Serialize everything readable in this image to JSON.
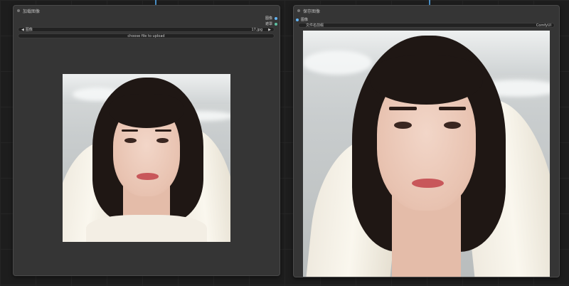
{
  "colors": {
    "canvas": "#1d1d1d",
    "node_bg": "#353535",
    "image_output_dot": "#64b5f6",
    "latent_output_dot": "#f06292",
    "image_input_dot": "#64b5f6",
    "wire": "#4a90c8"
  },
  "load_node": {
    "title": "加载图像",
    "outputs": [
      {
        "label": "图像",
        "type": "image"
      },
      {
        "label": "遮罩",
        "type": "mask"
      }
    ],
    "image_widget": {
      "label": "图像",
      "value": "17.jpg",
      "left_arrow": "◀",
      "right_arrow": "▶"
    },
    "upload_button": "choose file to upload"
  },
  "save_node": {
    "title": "保存图像",
    "inputs": [
      {
        "label": "图像",
        "type": "image"
      }
    ],
    "prefix_widget": {
      "label": "文件名前缀",
      "value": "ComfyUI"
    }
  }
}
